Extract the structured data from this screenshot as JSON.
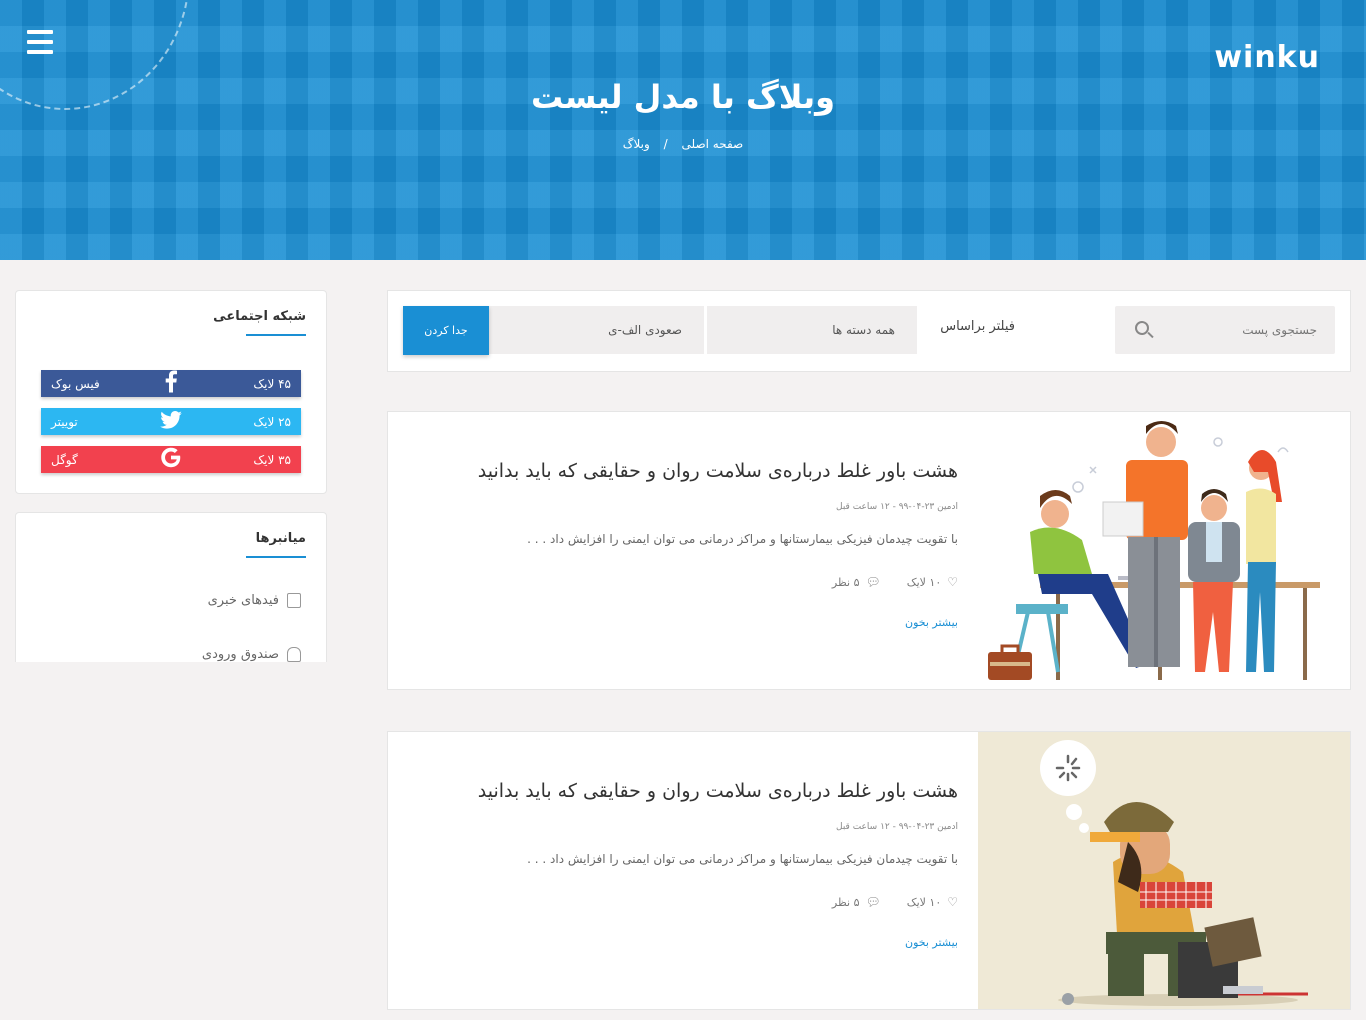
{
  "header": {
    "logo": "winku",
    "title": "وبلاگ با مدل لیست",
    "breadcrumb": [
      "صفحه اصلی",
      "وبلاگ"
    ]
  },
  "sidebar": {
    "social": {
      "title": "شبکه اجتماعی",
      "items": [
        {
          "name": "فیس بوک",
          "likes": "۴۵ لایک",
          "icon": "facebook-icon",
          "color": "#3b5998"
        },
        {
          "name": "توییتر",
          "likes": "۲۵ لایک",
          "icon": "twitter-icon",
          "color": "#2cb7f2"
        },
        {
          "name": "گوگل",
          "likes": "۳۵ لایک",
          "icon": "google-icon",
          "color": "#f2414e"
        }
      ]
    },
    "shortcuts": {
      "title": "میانبرها",
      "items": [
        {
          "label": "فیدهای خبری",
          "icon": "clipboard-icon"
        },
        {
          "label": "صندوق ورودی",
          "icon": "inbox-icon"
        }
      ]
    }
  },
  "filter": {
    "search_placeholder": "جستجوی پست",
    "label": "فیلتر براساس",
    "category": "همه دسته ها",
    "sort": "صعودی الف-ی",
    "submit": "جدا کردن"
  },
  "posts": [
    {
      "title": "هشت باور غلط درباره‌ی سلامت روان و حقایقی که باید بدانید",
      "meta": "ادمین ۲۳-۰۴-۹۹ - ۱۲ ساعت قبل",
      "excerpt": "با تقویت چیدمان فیزیکی بیمارستانها و مراکز درمانی می توان ایمنی را افزایش داد . . .",
      "likes": "۱۰ لایک",
      "comments": "۵ نظر",
      "read_more": "بیشتر بخون",
      "image": "team-meeting-illustration"
    },
    {
      "title": "هشت باور غلط درباره‌ی سلامت روان و حقایقی که باید بدانید",
      "meta": "ادمین ۲۳-۰۴-۹۹ - ۱۲ ساعت قبل",
      "excerpt": "با تقویت چیدمان فیزیکی بیمارستانها و مراکز درمانی می توان ایمنی را افزایش داد . . .",
      "likes": "۱۰ لایک",
      "comments": "۵ نظر",
      "read_more": "بیشتر بخون",
      "image": "tired-worker-illustration"
    }
  ],
  "colors": {
    "primary": "#1a8fd4",
    "background": "#f4f2f2"
  }
}
